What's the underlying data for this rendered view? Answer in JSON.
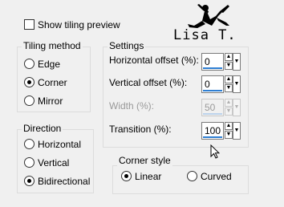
{
  "show_tiling_preview": {
    "label": "Show tiling preview",
    "checked": false
  },
  "logo": {
    "text": "Lisa T."
  },
  "tiling_method": {
    "title": "Tiling method",
    "options": [
      {
        "label": "Edge",
        "selected": false
      },
      {
        "label": "Corner",
        "selected": true
      },
      {
        "label": "Mirror",
        "selected": false
      }
    ]
  },
  "direction": {
    "title": "Direction",
    "options": [
      {
        "label": "Horizontal",
        "selected": false
      },
      {
        "label": "Vertical",
        "selected": false
      },
      {
        "label": "Bidirectional",
        "selected": true
      }
    ]
  },
  "settings": {
    "title": "Settings",
    "horizontal_offset": {
      "label": "Horizontal offset (%):",
      "value": "0"
    },
    "vertical_offset": {
      "label": "Vertical offset (%):",
      "value": "0"
    },
    "width": {
      "label": "Width (%):",
      "value": "50",
      "disabled": true
    },
    "transition": {
      "label": "Transition (%):",
      "value": "100"
    }
  },
  "corner_style": {
    "title": "Corner style",
    "options": [
      {
        "label": "Linear",
        "selected": true
      },
      {
        "label": "Curved",
        "selected": false
      }
    ]
  }
}
